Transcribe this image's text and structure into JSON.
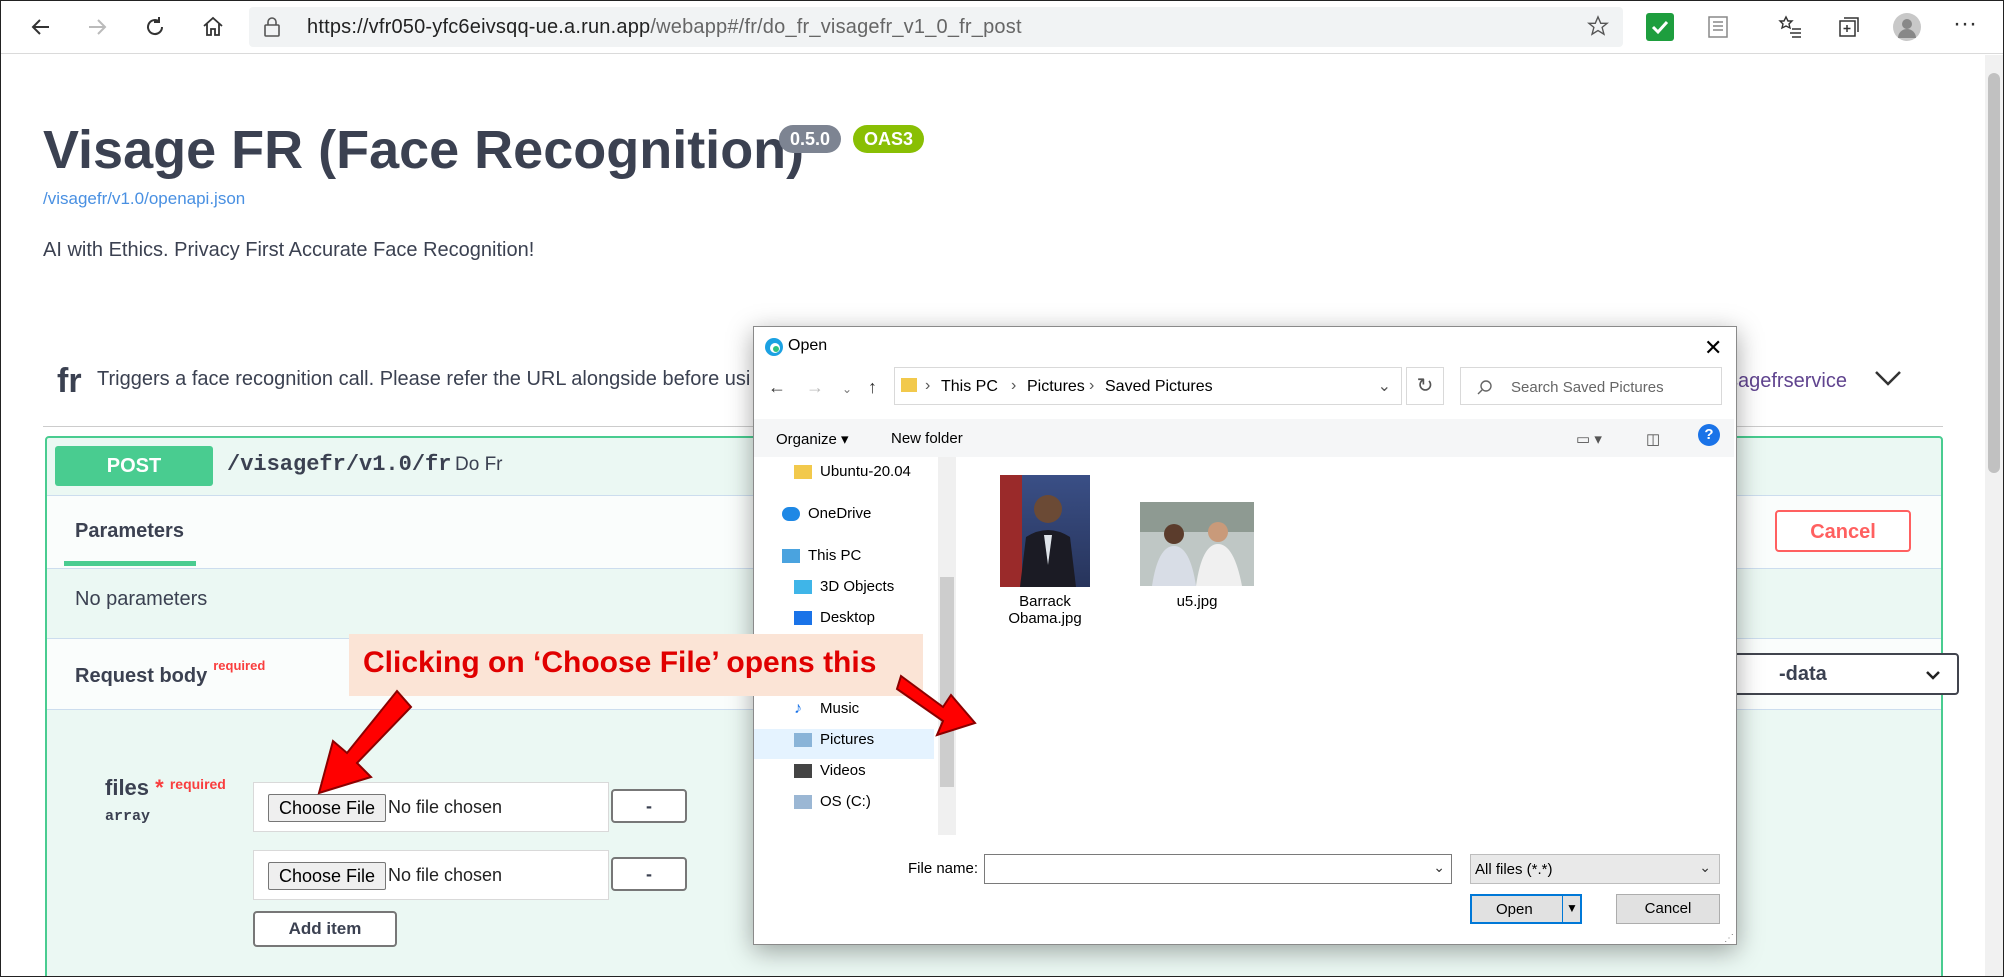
{
  "browser": {
    "url_host": "https://vfr050-yfc6eivsqq-ue.a.run.app",
    "url_path": "/webapp#/fr/do_fr_visagefr_v1_0_fr_post"
  },
  "page": {
    "title": "Visage FR (Face Recognition)",
    "version_badge": "0.5.0",
    "oas_badge": "OAS3",
    "spec_link": "/visagefr/v1.0/openapi.json",
    "description": "AI with Ethics. Privacy First Accurate Face Recognition!"
  },
  "tag": {
    "name": "fr",
    "description": "Triggers a face recognition call. Please refer the URL alongside before usi",
    "link": "sagefrservice"
  },
  "operation": {
    "method": "POST",
    "path": "/visagefr/v1.0/fr",
    "summary": "Do Fr",
    "params_tab": "Parameters",
    "cancel_label": "Cancel",
    "no_params": "No parameters",
    "request_body_label": "Request body",
    "required_label": "required",
    "content_type": "-data",
    "files_label": "files",
    "files_star": "*",
    "files_type": "array",
    "file_rows": [
      {
        "choose": "Choose File",
        "status": "No file chosen",
        "minus": "-"
      },
      {
        "choose": "Choose File",
        "status": "No file chosen",
        "minus": "-"
      }
    ],
    "add_item": "Add item"
  },
  "dialog": {
    "title": "Open",
    "breadcrumb": [
      "This PC",
      "Pictures",
      "Saved Pictures"
    ],
    "search_placeholder": "Search Saved Pictures",
    "organize": "Organize",
    "new_folder": "New folder",
    "tree": [
      "Ubuntu-20.04",
      "OneDrive",
      "This PC",
      "3D Objects",
      "Desktop",
      "Music",
      "Pictures",
      "Videos",
      "OS (C:)"
    ],
    "selected_tree_item": "Pictures",
    "files": [
      {
        "name_line1": "Barrack",
        "name_line2": "Obama.jpg"
      },
      {
        "name_line1": "u5.jpg",
        "name_line2": ""
      }
    ],
    "file_name_label": "File name:",
    "file_name_value": "",
    "file_type": "All files (*.*)",
    "open_label": "Open",
    "cancel_label": "Cancel"
  },
  "annotation": {
    "callout_text": "Clicking on ‘Choose File’ opens this"
  },
  "colors": {
    "post_green": "#49cc90",
    "op_bg": "#ebf8f3",
    "callout_red": "#e00000",
    "callout_bg": "#fbe4d6",
    "badge_gray": "#7d8492",
    "badge_green": "#89bf04"
  }
}
